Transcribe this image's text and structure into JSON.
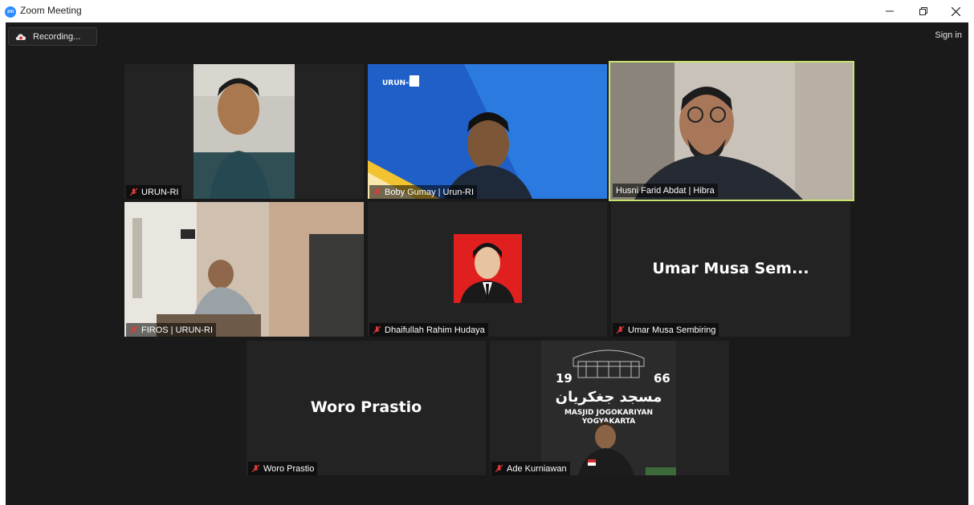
{
  "window": {
    "title": "Zoom Meeting",
    "app_icon_text": "zm"
  },
  "toolbar": {
    "recording_label": "Recording...",
    "sign_in_label": "Sign in"
  },
  "participants": [
    {
      "name": "URUN-RI",
      "muted": true,
      "video": true
    },
    {
      "name": "Boby Gumay | Urun-RI",
      "muted": true,
      "video": true,
      "background_logo": "URUN-RI"
    },
    {
      "name": "Husni Farid Abdat | Hibra",
      "muted": false,
      "video": true,
      "active_speaker": true
    },
    {
      "name": "FIROS | URUN-RI",
      "muted": true,
      "video": true
    },
    {
      "name": "Dhaifullah Rahim Hudaya",
      "muted": true,
      "video": true
    },
    {
      "name": "Umar Musa Sembiring",
      "display_name": "Umar Musa Sem...",
      "muted": true,
      "video": false
    },
    {
      "name": "Woro Prastio",
      "display_name": "Woro Prastio",
      "muted": true,
      "video": false
    },
    {
      "name": "Ade Kurniawan",
      "muted": true,
      "video": true,
      "background_text": {
        "year_left": "19",
        "year_right": "66",
        "arabic": "مسجد جغكريان",
        "line1": "MASJID JOGOKARIYAN",
        "line2": "YOGYAKARTA"
      }
    }
  ],
  "colors": {
    "active_speaker_border": "#c9e46e",
    "mute_icon": "#e03a3a",
    "zoom_blue": "#2d8cff"
  }
}
